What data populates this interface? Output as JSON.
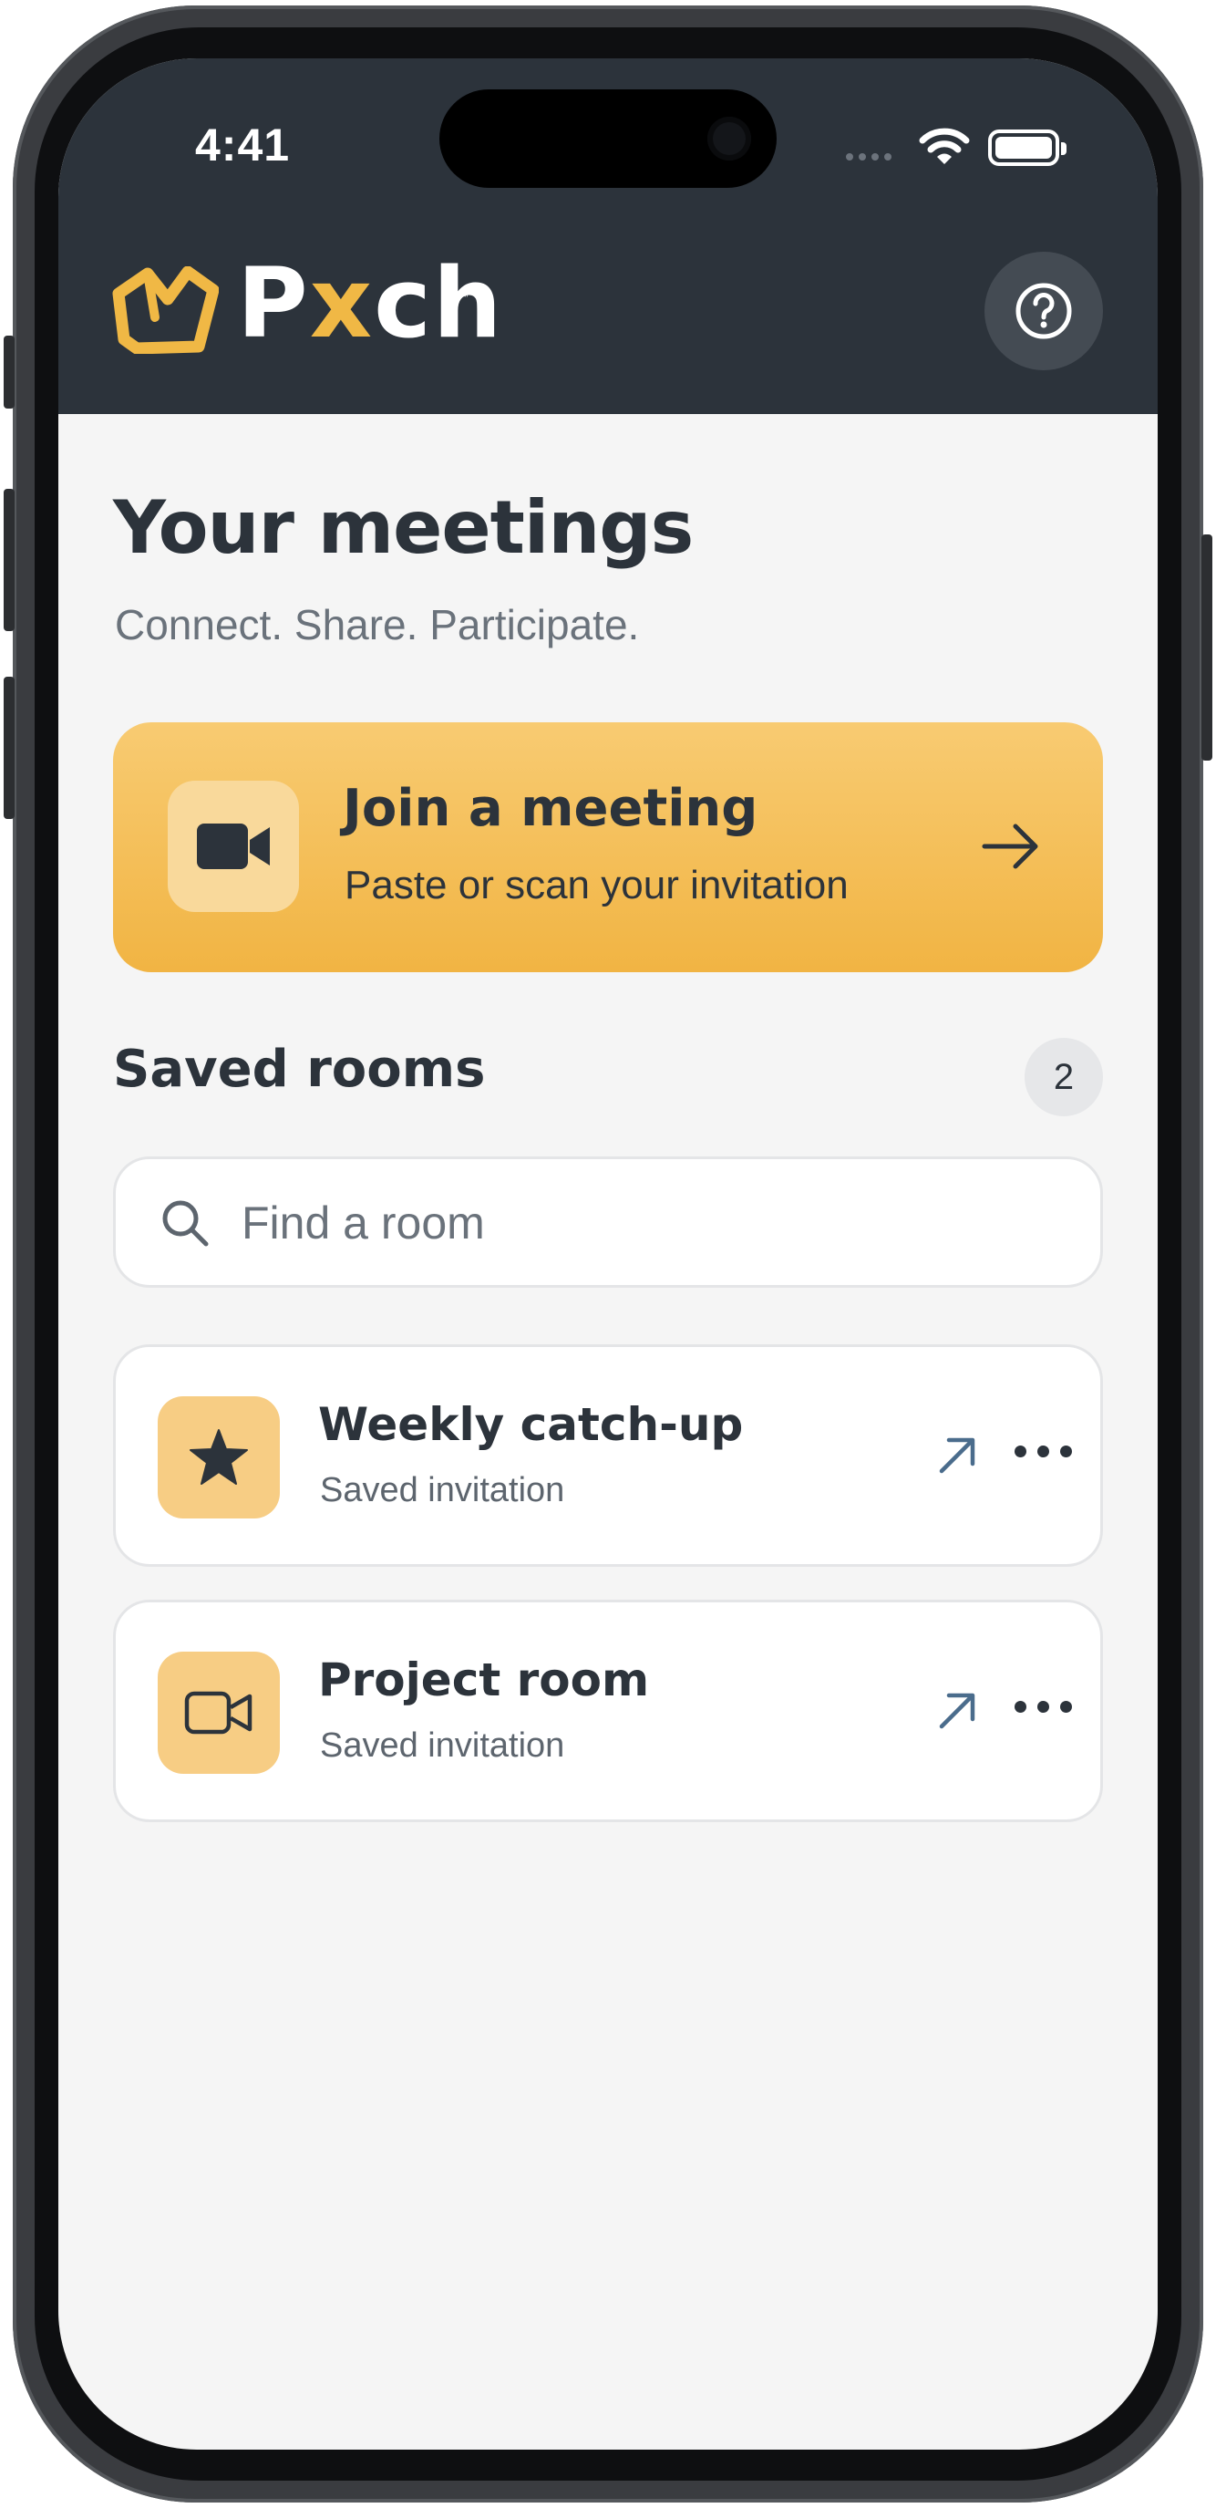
{
  "status_bar": {
    "time": "4:41"
  },
  "header": {
    "logo_text_p": "P",
    "logo_text_x": "x",
    "logo_text_ch": "ch",
    "logo_tm": "™",
    "help_icon": "question-circle-icon"
  },
  "main": {
    "title": "Your meetings",
    "subtitle": "Connect. Share. Participate.",
    "join_card": {
      "title": "Join a meeting",
      "subtitle": "Paste or scan your invitation",
      "icon": "video-camera-icon"
    },
    "saved_rooms": {
      "title": "Saved rooms",
      "count": "2",
      "search_placeholder": "Find a room",
      "rooms": [
        {
          "title": "Weekly catch-up",
          "subtitle": "Saved invitation",
          "icon": "star-icon"
        },
        {
          "title": "Project room",
          "subtitle": "Saved invitation",
          "icon": "video-outline-icon"
        }
      ]
    }
  },
  "colors": {
    "header_bg": "#2c333b",
    "accent": "#f0b845",
    "page_bg": "#f5f5f5",
    "text_dark": "#2c333b",
    "text_muted": "#6a727b"
  }
}
